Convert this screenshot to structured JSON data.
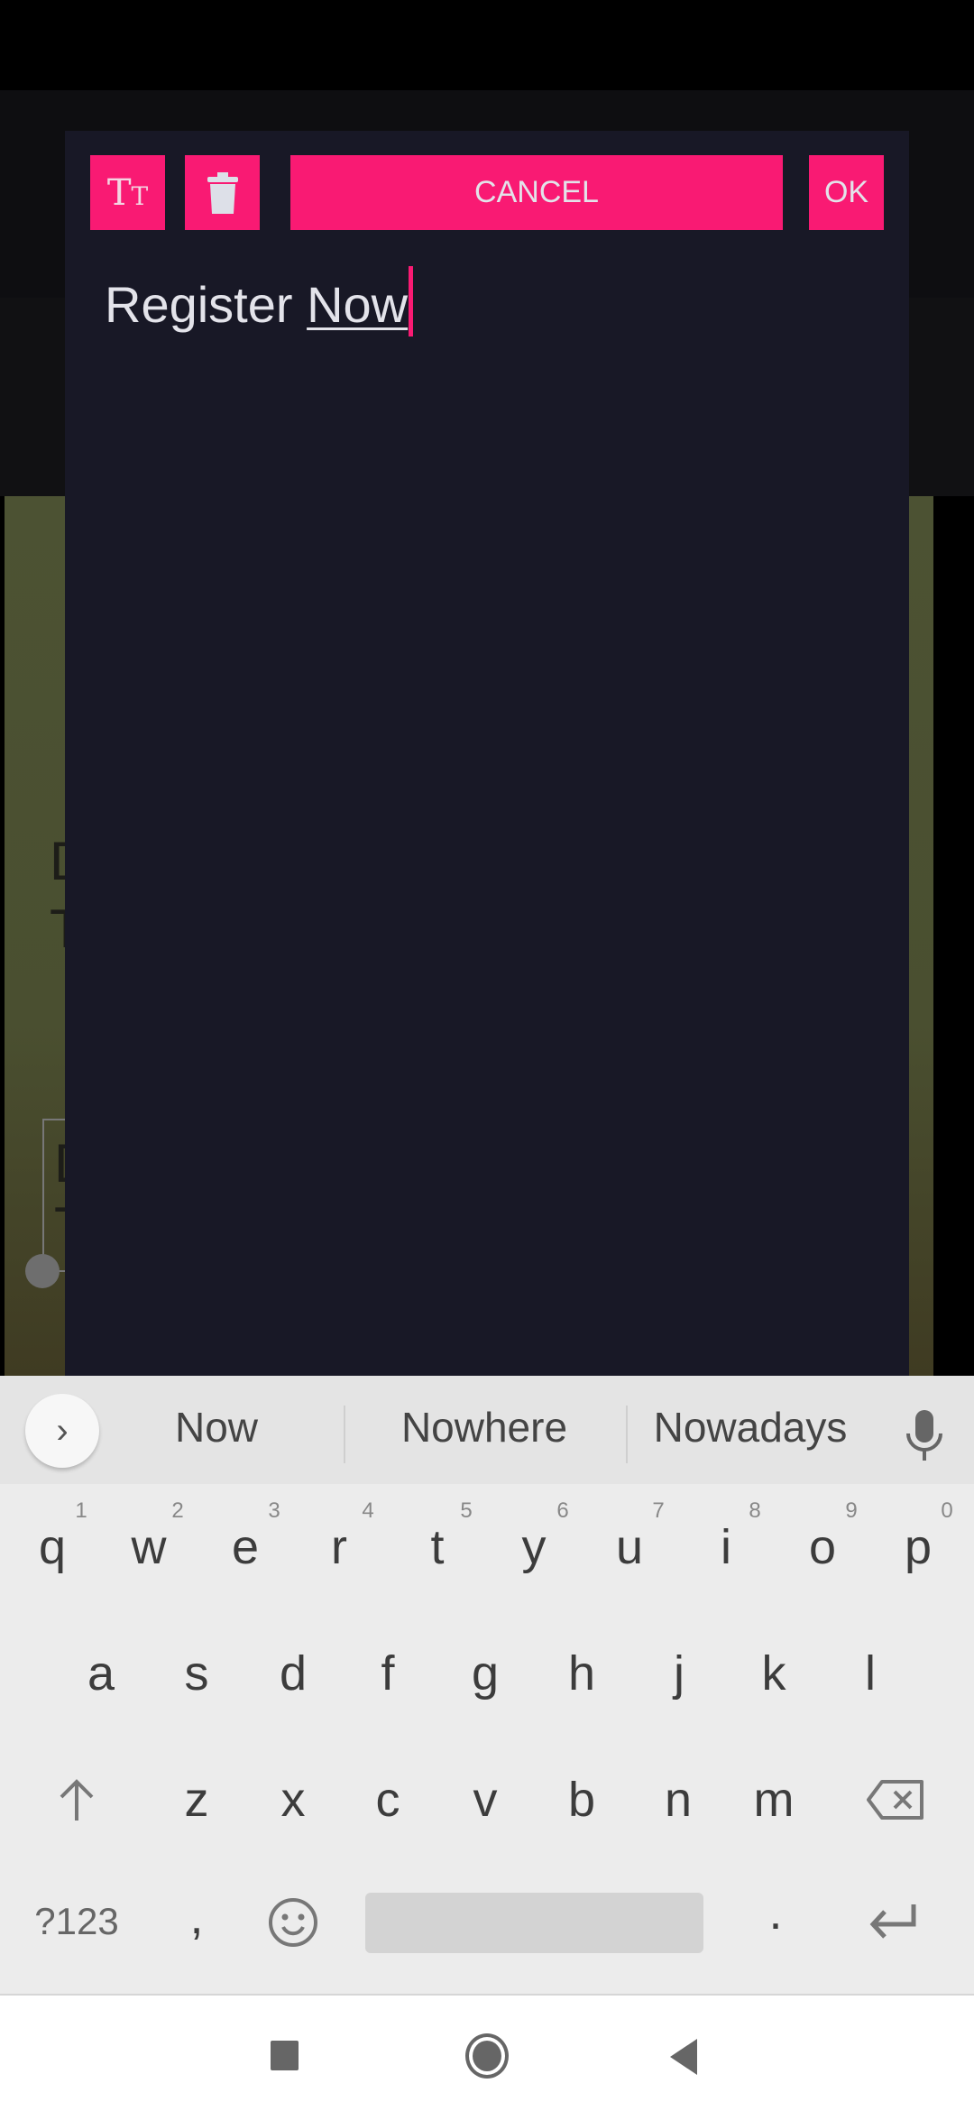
{
  "colors": {
    "accent": "#f91a73",
    "dialog_bg": "#181826",
    "text": "#e3e3ea",
    "keyboard_bg": "#ececec"
  },
  "background": {
    "partial_text": [
      "D",
      "T",
      "D",
      "T"
    ]
  },
  "dialog": {
    "text_size_icon": "text-size-icon",
    "delete_icon": "trash-icon",
    "cancel_label": "CANCEL",
    "ok_label": "OK",
    "text_before": "Register ",
    "text_composing": "Now"
  },
  "keyboard": {
    "suggestions": [
      "Now",
      "Nowhere",
      "Nowadays"
    ],
    "row1": [
      {
        "k": "q",
        "h": "1"
      },
      {
        "k": "w",
        "h": "2"
      },
      {
        "k": "e",
        "h": "3"
      },
      {
        "k": "r",
        "h": "4"
      },
      {
        "k": "t",
        "h": "5"
      },
      {
        "k": "y",
        "h": "6"
      },
      {
        "k": "u",
        "h": "7"
      },
      {
        "k": "i",
        "h": "8"
      },
      {
        "k": "o",
        "h": "9"
      },
      {
        "k": "p",
        "h": "0"
      }
    ],
    "row2": [
      "a",
      "s",
      "d",
      "f",
      "g",
      "h",
      "j",
      "k",
      "l"
    ],
    "row3": [
      "z",
      "x",
      "c",
      "v",
      "b",
      "n",
      "m"
    ],
    "symbols_label": "?123",
    "comma": ",",
    "period": "."
  }
}
